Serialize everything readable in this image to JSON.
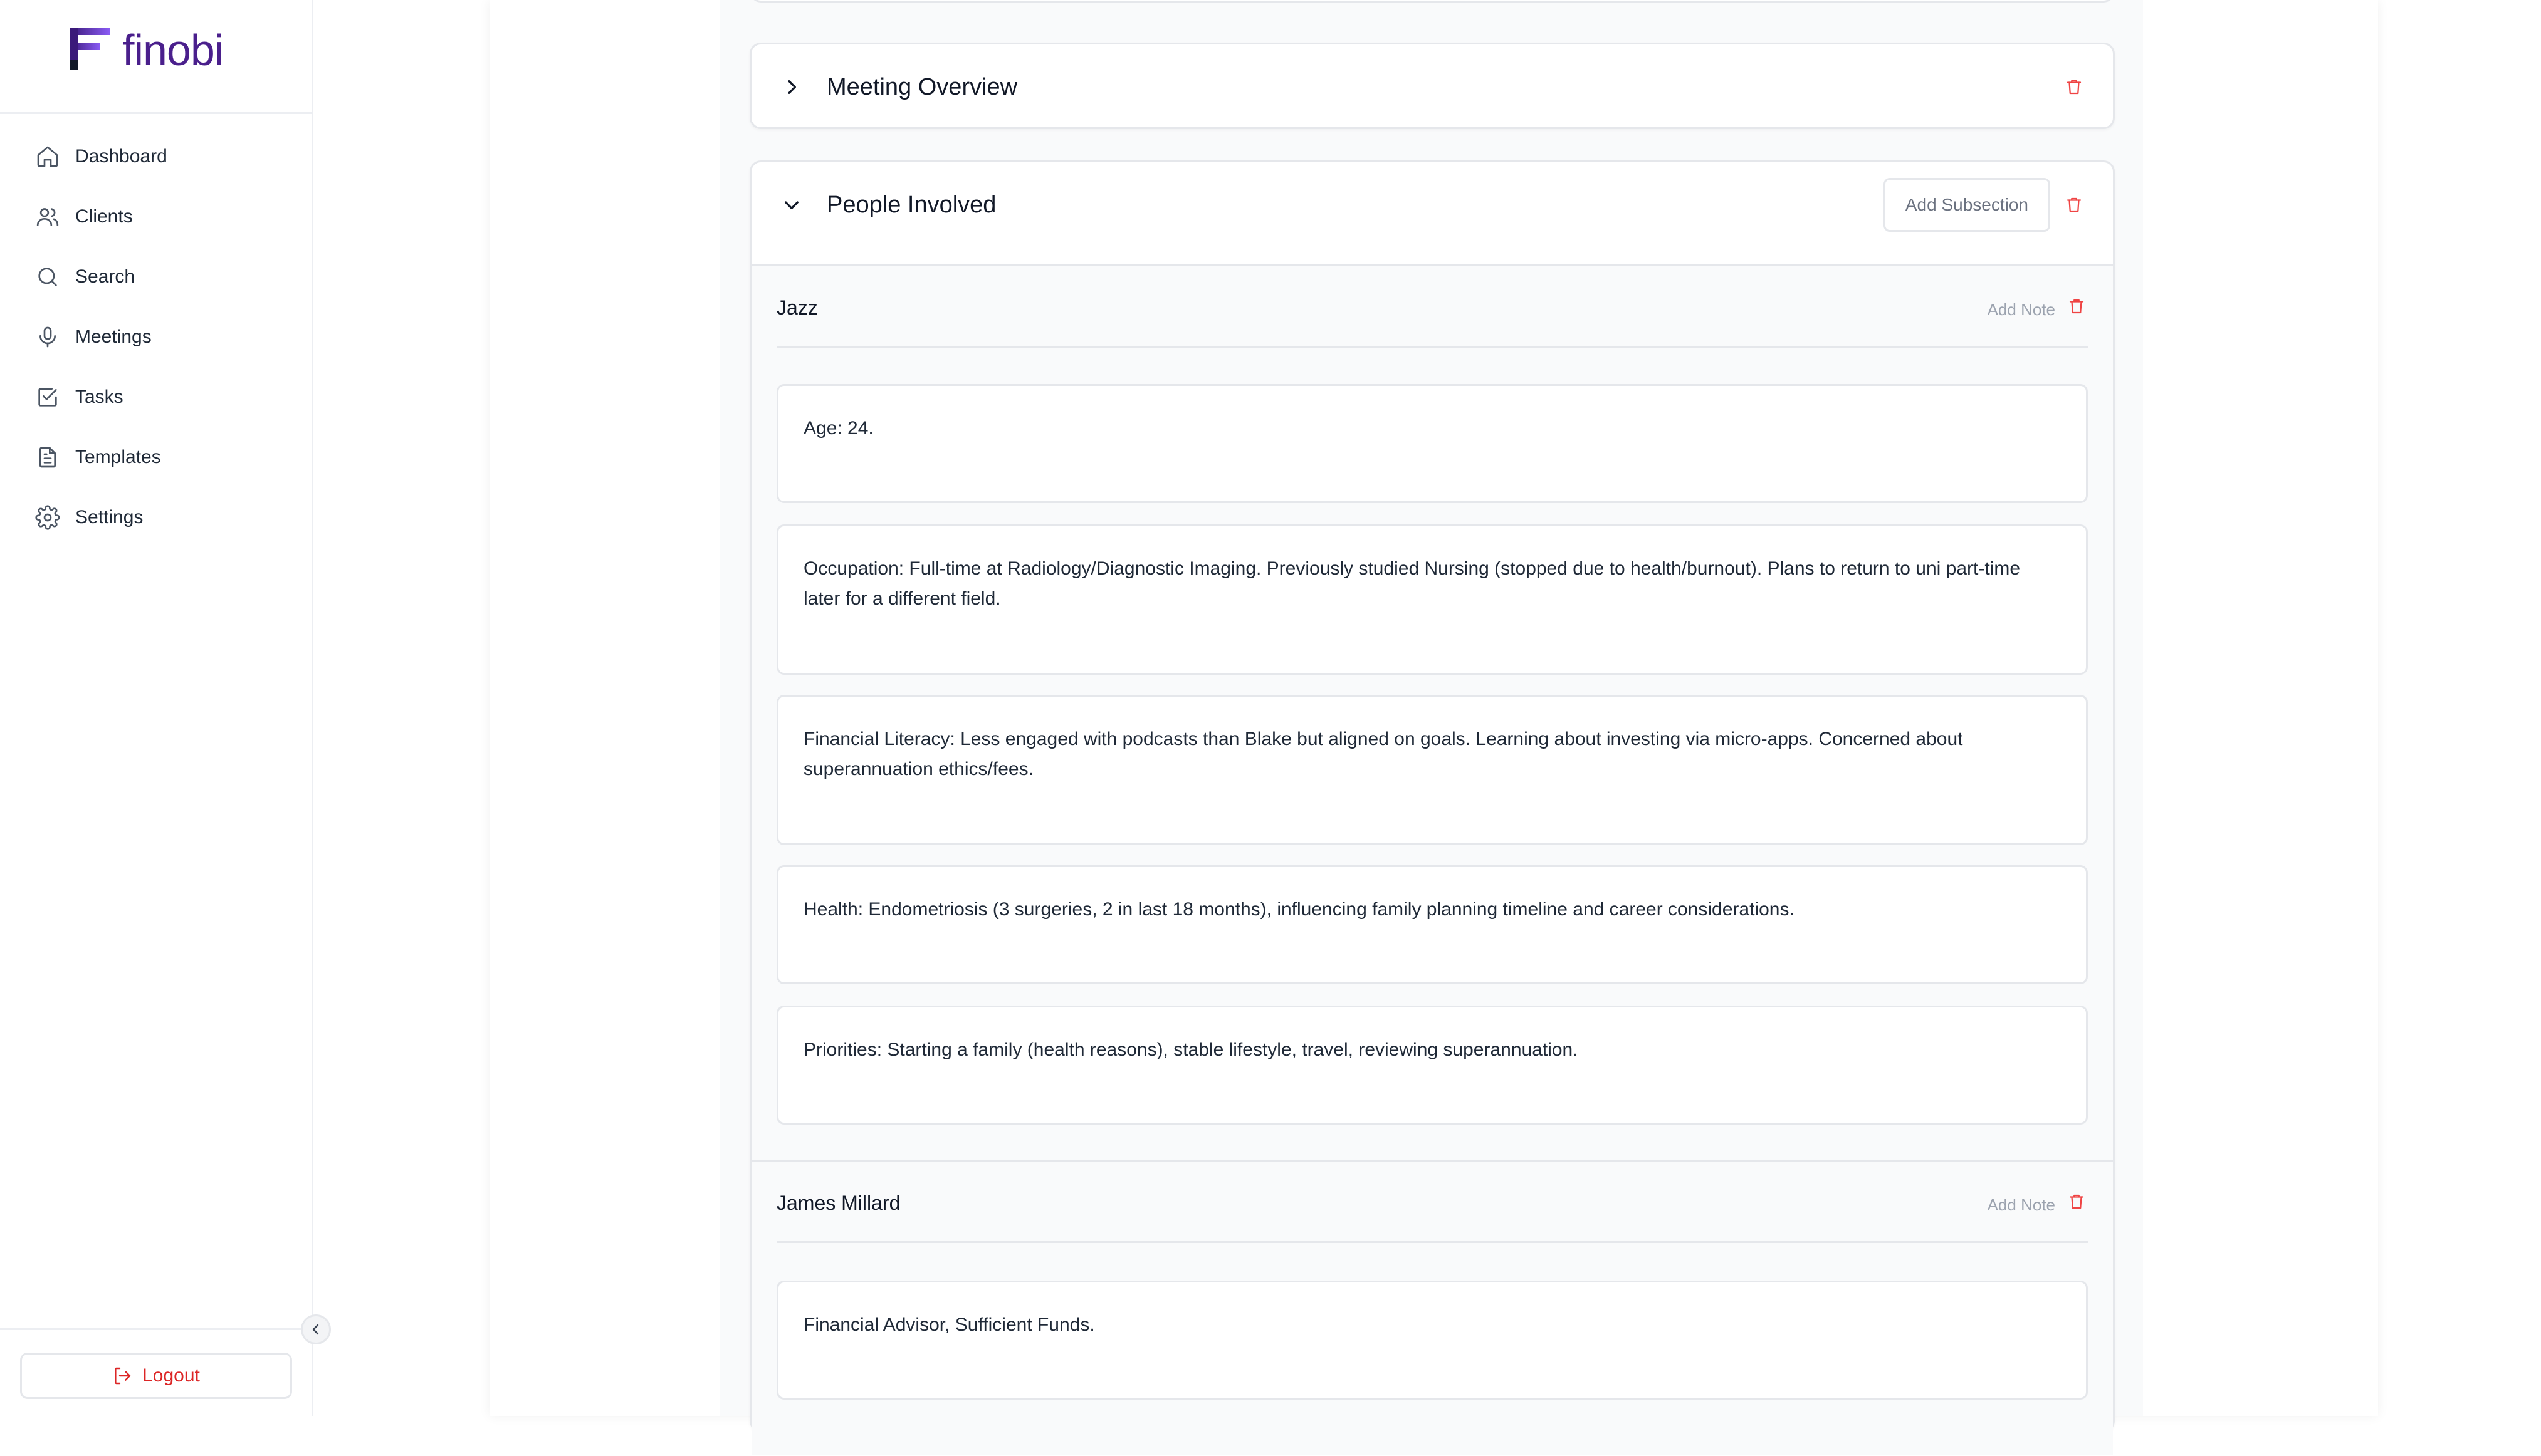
{
  "app": {
    "name": "finobi",
    "brand_color": "#4a1f8c",
    "danger_color": "#dc2626"
  },
  "sidebar": {
    "items": [
      {
        "label": "Dashboard",
        "icon": "home-icon"
      },
      {
        "label": "Clients",
        "icon": "users-icon"
      },
      {
        "label": "Search",
        "icon": "search-icon"
      },
      {
        "label": "Meetings",
        "icon": "microphone-icon"
      },
      {
        "label": "Tasks",
        "icon": "check-square-icon"
      },
      {
        "label": "Templates",
        "icon": "document-icon"
      },
      {
        "label": "Settings",
        "icon": "gear-icon"
      }
    ],
    "logout_label": "Logout"
  },
  "sections": [
    {
      "title": "Meeting Overview",
      "expanded": false
    },
    {
      "title": "People Involved",
      "expanded": true,
      "add_subsection_label": "Add Subsection",
      "subsections": [
        {
          "name": "Jazz",
          "add_note_label": "Add Note",
          "notes": [
            "Age: 24.",
            "Occupation: Full-time at Radiology/Diagnostic Imaging. Previously studied Nursing (stopped due to health/burnout). Plans to return to uni part-time later for a different field.",
            "Financial Literacy: Less engaged with podcasts than Blake but aligned on goals. Learning about investing via micro-apps. Concerned about superannuation ethics/fees.",
            "Health: Endometriosis (3 surgeries, 2 in last 18 months), influencing family planning timeline and career considerations.",
            "Priorities: Starting a family (health reasons), stable lifestyle, travel, reviewing superannuation."
          ]
        },
        {
          "name": "James Millard",
          "add_note_label": "Add Note",
          "notes": [
            "Financial Advisor, Sufficient Funds."
          ]
        }
      ]
    }
  ]
}
